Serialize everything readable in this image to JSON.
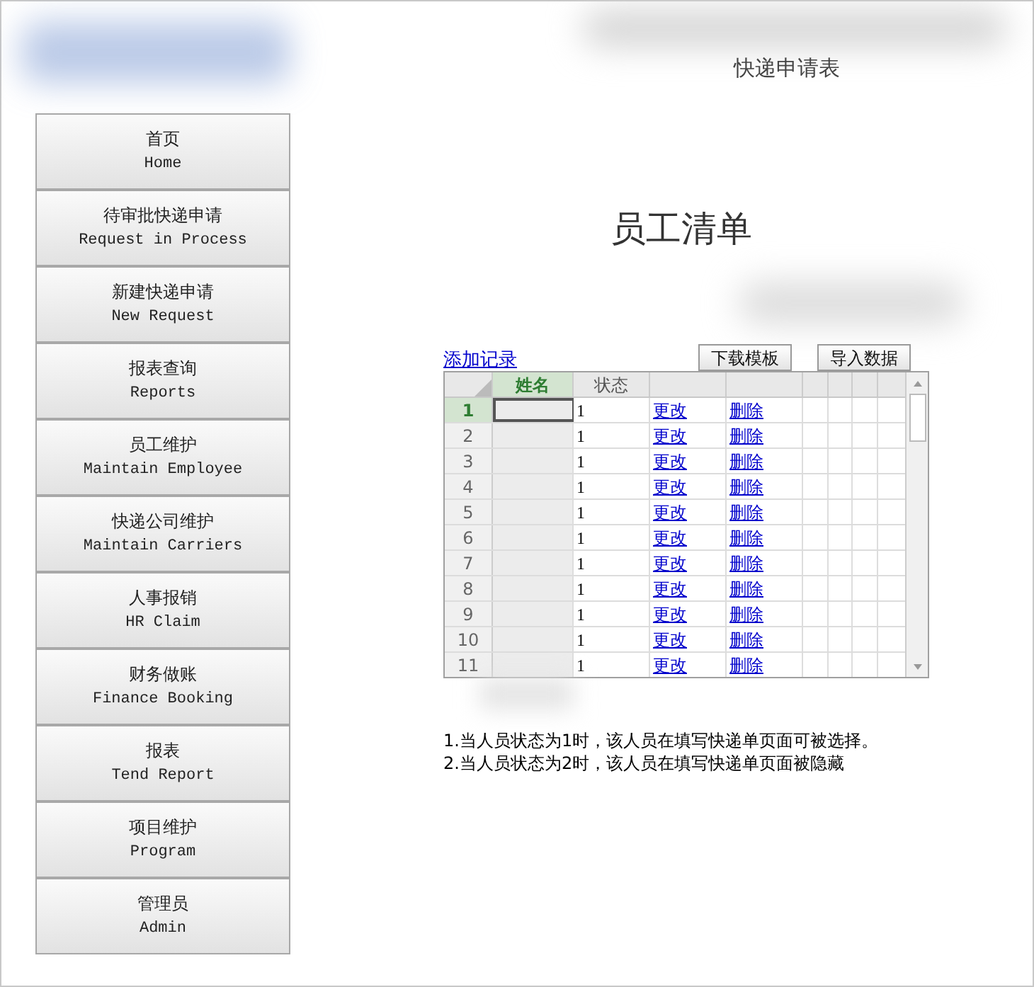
{
  "header": {
    "title": "快递申请表"
  },
  "sidebar": {
    "items": [
      {
        "label": "首页",
        "sublabel": "Home"
      },
      {
        "label": "待审批快递申请",
        "sublabel": "Request in Process"
      },
      {
        "label": "新建快递申请",
        "sublabel": "New Request"
      },
      {
        "label": "报表查询",
        "sublabel": "Reports"
      },
      {
        "label": "员工维护",
        "sublabel": "Maintain Employee"
      },
      {
        "label": "快递公司维护",
        "sublabel": "Maintain Carriers"
      },
      {
        "label": "人事报销",
        "sublabel": "HR Claim"
      },
      {
        "label": "财务做账",
        "sublabel": "Finance Booking"
      },
      {
        "label": "报表",
        "sublabel": "Tend Report"
      },
      {
        "label": "项目维护",
        "sublabel": "Program"
      },
      {
        "label": "管理员",
        "sublabel": "Admin"
      }
    ]
  },
  "page_title": "员工清单",
  "toolbar": {
    "add_link": "添加记录",
    "buttons": [
      "下载模板",
      "导入数据"
    ]
  },
  "grid": {
    "columns": [
      {
        "label": "姓名",
        "selected": true
      },
      {
        "label": "状态",
        "selected": false
      }
    ],
    "rows": [
      {
        "number": "1",
        "status": "1",
        "edit": "更改",
        "delete": "删除",
        "selected": true
      },
      {
        "number": "2",
        "status": "1",
        "edit": "更改",
        "delete": "删除",
        "selected": false
      },
      {
        "number": "3",
        "status": "1",
        "edit": "更改",
        "delete": "删除",
        "selected": false
      },
      {
        "number": "4",
        "status": "1",
        "edit": "更改",
        "delete": "删除",
        "selected": false
      },
      {
        "number": "5",
        "status": "1",
        "edit": "更改",
        "delete": "删除",
        "selected": false
      },
      {
        "number": "6",
        "status": "1",
        "edit": "更改",
        "delete": "删除",
        "selected": false
      },
      {
        "number": "7",
        "status": "1",
        "edit": "更改",
        "delete": "删除",
        "selected": false
      },
      {
        "number": "8",
        "status": "1",
        "edit": "更改",
        "delete": "删除",
        "selected": false
      },
      {
        "number": "9",
        "status": "1",
        "edit": "更改",
        "delete": "删除",
        "selected": false
      },
      {
        "number": "10",
        "status": "1",
        "edit": "更改",
        "delete": "删除",
        "selected": false
      },
      {
        "number": "11",
        "status": "1",
        "edit": "更改",
        "delete": "删除",
        "selected": false
      }
    ]
  },
  "notes": [
    "1.当人员状态为1时，该人员在填写快递单页面可被选择。",
    "2.当人员状态为2时，该人员在填写快递单页面被隐藏"
  ]
}
